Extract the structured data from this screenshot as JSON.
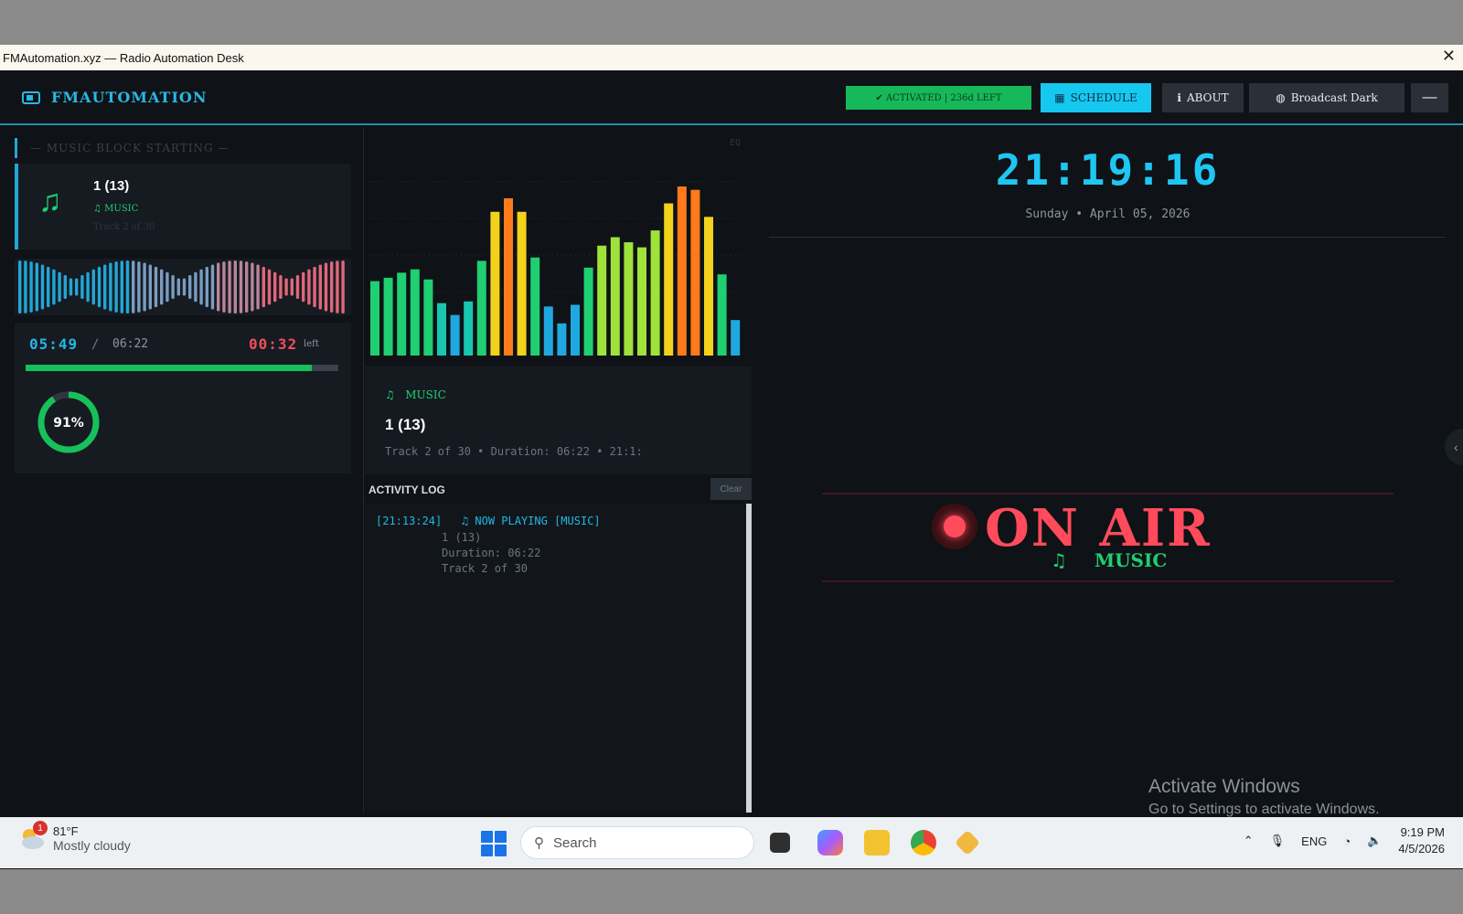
{
  "window": {
    "title": "FMAutomation.xyz — Radio Automation Desk",
    "close_glyph": "✕"
  },
  "header": {
    "brand": "FMAUTOMATION",
    "activated": "✔ ACTIVATED  |  236d LEFT",
    "schedule": "SCHEDULE",
    "about": "ABOUT",
    "theme": "Broadcast Dark",
    "minimize": "—"
  },
  "left": {
    "block_header": "— MUSIC BLOCK STARTING —",
    "now": {
      "title": "1 (13)",
      "category": "MUSIC",
      "sub": "Track 2 of 30"
    },
    "elapsed": "05:49",
    "slash": "/",
    "total": "06:22",
    "remaining": "00:32",
    "remaining_label": "left",
    "progress": 0.914,
    "gauge_percent": 91,
    "gauge_label": "91%"
  },
  "eq": {
    "label": "EQ",
    "levels": [
      0.44,
      0.46,
      0.49,
      0.51,
      0.45,
      0.31,
      0.24,
      0.32,
      0.56,
      0.85,
      0.93,
      0.85,
      0.58,
      0.29,
      0.19,
      0.3,
      0.52,
      0.65,
      0.7,
      0.67,
      0.64,
      0.74,
      0.9,
      1.0,
      0.98,
      0.82,
      0.48,
      0.21
    ]
  },
  "track": {
    "category": "MUSIC",
    "title": "1 (13)",
    "meta": "Track 2 of 30   •   Duration: 06:22   •   21:1:"
  },
  "log": {
    "header": "ACTIVITY LOG",
    "clear": "Clear",
    "entries": [
      {
        "time": "[21:13:24]",
        "event": "NOW PLAYING [MUSIC]",
        "lines": [
          "1 (13)",
          "Duration: 06:22",
          "Track 2 of 30"
        ]
      }
    ]
  },
  "right": {
    "clock": "21:19:16",
    "date": "Sunday   •   April 05, 2026",
    "onair": "ON AIR",
    "onair_category": "MUSIC",
    "watermark_title": "Activate Windows",
    "watermark_sub": "Go to Settings to activate Windows.",
    "side_tab": "‹"
  },
  "taskbar": {
    "weather_temp": "81°F",
    "weather_cond": "Mostly cloudy",
    "weather_badge": "1",
    "search_placeholder": "Search",
    "tray_lang": "ENG",
    "time": "9:19 PM",
    "date": "4/5/2026"
  },
  "colors": {
    "accent": "#22b7e6",
    "green": "#16c05a",
    "red": "#ff4b5c"
  }
}
